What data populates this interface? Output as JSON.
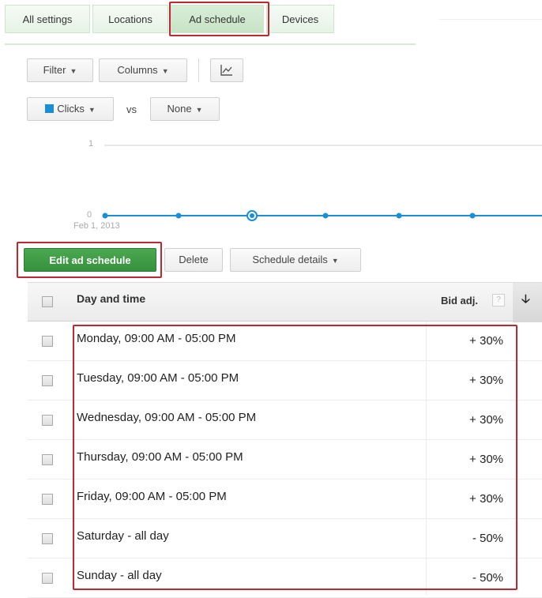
{
  "tabs": {
    "all_settings": "All settings",
    "locations": "Locations",
    "ad_schedule": "Ad schedule",
    "devices": "Devices"
  },
  "toolbar": {
    "filter": "Filter",
    "columns": "Columns",
    "chart_icon": "line-chart-icon"
  },
  "metrics": {
    "primary": "Clicks",
    "vs": "vs",
    "secondary": "None",
    "primary_color": "#1a8fd6"
  },
  "chart_data": {
    "type": "line",
    "x": [
      "Feb 1, 2013",
      "",
      "",
      "",
      "",
      "",
      ""
    ],
    "values": [
      0,
      0,
      0,
      0,
      0,
      0,
      0
    ],
    "ytick_top": "1",
    "ytick_bottom": "0",
    "xtick_first": "Feb 1, 2013",
    "ylim": [
      0,
      1
    ],
    "highlighted_index": 2,
    "line_color": "#1a8fd6"
  },
  "actions": {
    "edit": "Edit ad schedule",
    "delete": "Delete",
    "details": "Schedule details"
  },
  "table": {
    "headers": {
      "day_time": "Day and time",
      "bid_adj": "Bid adj.",
      "help": "?",
      "sort": "🡣"
    },
    "rows": [
      {
        "day": "Monday, 09:00 AM - 05:00 PM",
        "bid": "+ 30%"
      },
      {
        "day": "Tuesday, 09:00 AM - 05:00 PM",
        "bid": "+ 30%"
      },
      {
        "day": "Wednesday, 09:00 AM - 05:00 PM",
        "bid": "+ 30%"
      },
      {
        "day": "Thursday, 09:00 AM - 05:00 PM",
        "bid": "+ 30%"
      },
      {
        "day": "Friday, 09:00 AM - 05:00 PM",
        "bid": "+ 30%"
      },
      {
        "day": "Saturday - all day",
        "bid": "- 50%"
      },
      {
        "day": "Sunday - all day",
        "bid": "- 50%"
      }
    ]
  },
  "colors": {
    "accent_green": "#3f9a45",
    "highlight_red": "#c0282e"
  }
}
